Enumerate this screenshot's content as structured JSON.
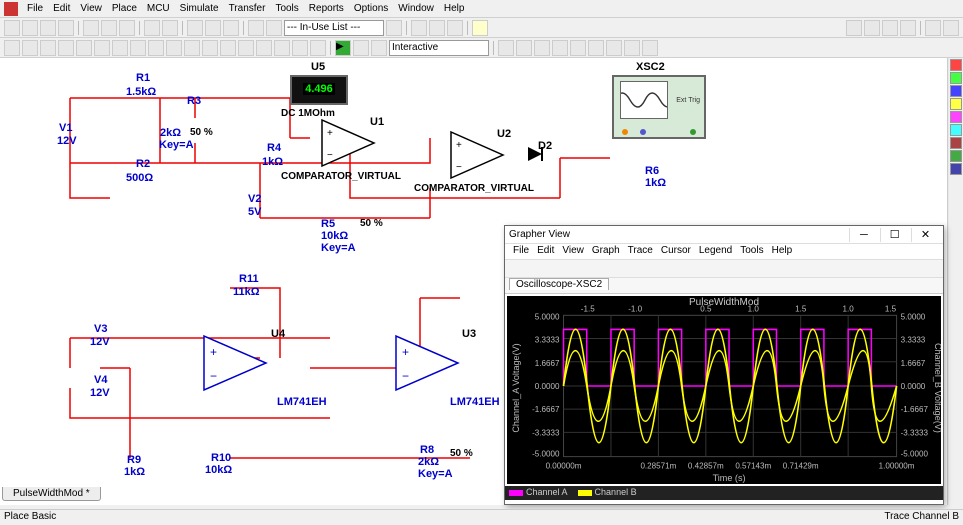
{
  "main_menu": [
    "File",
    "Edit",
    "View",
    "Place",
    "MCU",
    "Simulate",
    "Transfer",
    "Tools",
    "Reports",
    "Options",
    "Window",
    "Help"
  ],
  "combo1": "--- In-Use List ---",
  "combo2": "Interactive",
  "schematic": {
    "U5": {
      "ref": "U5",
      "display": "4.496",
      "info": "DC  1MOhm"
    },
    "U1": {
      "ref": "U1",
      "type": "COMPARATOR_VIRTUAL"
    },
    "U2": {
      "ref": "U2",
      "type": "COMPARATOR_VIRTUAL"
    },
    "U3": {
      "ref": "U3",
      "type": "LM741EH"
    },
    "U4": {
      "ref": "U4",
      "type": "LM741EH"
    },
    "D2": "D2",
    "XSC2": "XSC2",
    "XSC2_sub": "Ext Trig",
    "V1": {
      "ref": "V1",
      "val": "12V"
    },
    "V2": {
      "ref": "V2",
      "val": "5V"
    },
    "V3": {
      "ref": "V3",
      "val": "12V"
    },
    "V4": {
      "ref": "V4",
      "val": "12V"
    },
    "R1": {
      "ref": "R1",
      "val": "1.5kΩ"
    },
    "R2": {
      "ref": "R2",
      "val": "500Ω"
    },
    "R3": {
      "ref": "R3",
      "val": "2kΩ",
      "pct": "50 %",
      "key": "Key=A"
    },
    "R4": {
      "ref": "R4",
      "val": "1kΩ"
    },
    "R5": {
      "ref": "R5",
      "val": "10kΩ",
      "pct": "50 %",
      "key": "Key=A"
    },
    "R6": {
      "ref": "R6",
      "val": "1kΩ"
    },
    "R8": {
      "ref": "R8",
      "val": "2kΩ",
      "pct": "50 %",
      "key": "Key=A"
    },
    "R9": {
      "ref": "R9",
      "val": "1kΩ"
    },
    "R10": {
      "ref": "R10",
      "val": "10kΩ"
    },
    "R11": {
      "ref": "R11",
      "val": "11kΩ"
    }
  },
  "tab_name": "PulseWidthMod *",
  "status_left": "Place Basic",
  "status_right": "Trace  Channel B",
  "grapher": {
    "title": "Grapher View",
    "menu": [
      "File",
      "Edit",
      "View",
      "Graph",
      "Trace",
      "Cursor",
      "Legend",
      "Tools",
      "Help"
    ],
    "tab": "Oscilloscope-XSC2",
    "plot_title": "PulseWidthMod",
    "xlabel": "Time (s)",
    "ylabel_l": "Channel_A Voltage(V)",
    "ylabel_r": "Channel_B Voltage(V)",
    "legend": [
      "Channel A",
      "Channel B"
    ]
  },
  "chart_data": {
    "type": "line",
    "title": "PulseWidthMod",
    "xlabel": "Time (s)",
    "ylabel": "Voltage (V)",
    "x_ticks_top": [
      "-1.5",
      "-1.0",
      "0.5",
      "1.0",
      "1.5",
      "1.0",
      "1.5"
    ],
    "x_ticks_bottom": [
      "0.00000m",
      "0.28571m",
      "0.42857m",
      "0.57143m",
      "0.71429m",
      "1.00000m"
    ],
    "y_ticks_left": [
      "5.0000",
      "3.3333",
      "1.6667",
      "0.0000",
      "-1.6667",
      "-3.3333",
      "-5.0000"
    ],
    "y_ticks_right": [
      "5.0000",
      "3.3333",
      "1.6667",
      "0.0000",
      "-1.6667",
      "-3.3333",
      "-5.0000"
    ],
    "xlim": [
      0,
      0.001
    ],
    "ylim": [
      -5,
      5
    ],
    "series": [
      {
        "name": "Channel A",
        "color": "#ff00ff",
        "type": "square",
        "period": 0.000143,
        "low": 0,
        "high": 4.0,
        "duty": 0.5
      },
      {
        "name": "Channel B",
        "color": "#ffff00",
        "type": "sine",
        "period": 0.000143,
        "amplitude": 5.0,
        "offset": 0
      }
    ]
  }
}
